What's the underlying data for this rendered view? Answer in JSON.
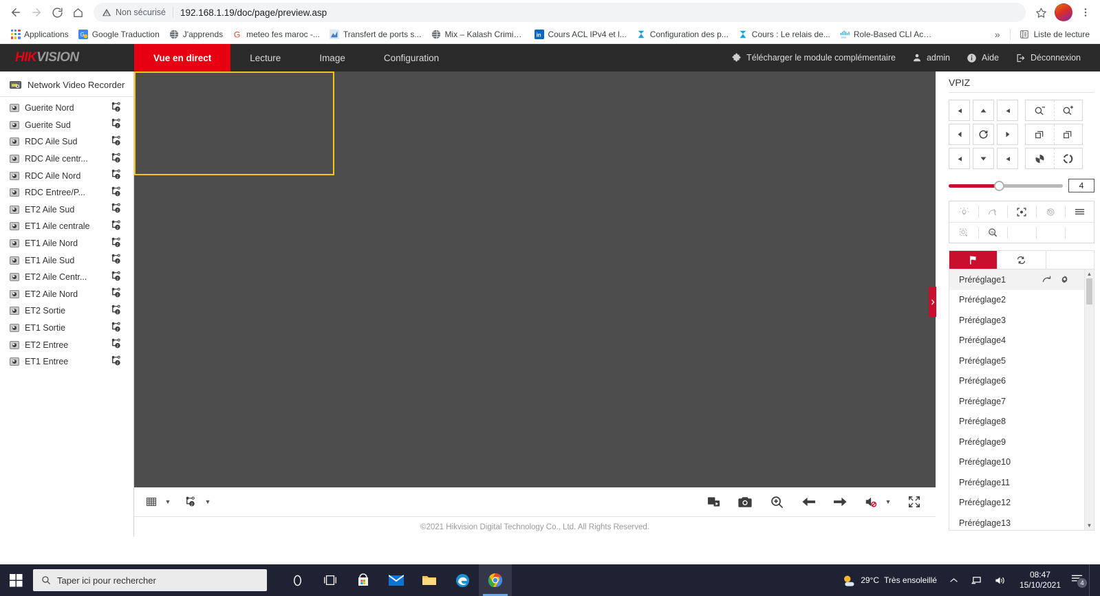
{
  "browser": {
    "back_icon": "back-arrow-icon",
    "forward_icon": "forward-arrow-icon",
    "reload_icon": "reload-icon",
    "home_icon": "home-icon",
    "security_label": "Non sécurisé",
    "url": "192.168.1.19/doc/page/preview.asp",
    "star_icon": "bookmark-star-icon",
    "menu_icon": "kebab-menu-icon",
    "bookmarks": [
      {
        "label": "Applications",
        "icon": "apps-grid-icon"
      },
      {
        "label": "Google Traduction",
        "icon": "google-translate-icon"
      },
      {
        "label": "J'apprends",
        "icon": "globe-icon"
      },
      {
        "label": "meteo fes maroc -...",
        "icon": "google-g-icon"
      },
      {
        "label": "Transfert de ports s...",
        "icon": "chart-icon"
      },
      {
        "label": "Mix – Kalash Crimin...",
        "icon": "globe-icon"
      },
      {
        "label": "Cours ACL IPv4 et l...",
        "icon": "linkedin-icon"
      },
      {
        "label": "Configuration des p...",
        "icon": "netacad-icon"
      },
      {
        "label": "Cours : Le relais de...",
        "icon": "netacad-icon"
      },
      {
        "label": "Role-Based CLI Acc...",
        "icon": "cisco-icon"
      }
    ],
    "overflow_label": "»",
    "reading_list_label": "Liste de lecture",
    "reading_list_icon": "reading-list-icon"
  },
  "hikvision": {
    "logo_red": "HIK",
    "logo_grey": "VISION",
    "nav": [
      {
        "label": "Vue en direct",
        "active": true
      },
      {
        "label": "Lecture",
        "active": false
      },
      {
        "label": "Image",
        "active": false
      },
      {
        "label": "Configuration",
        "active": false
      }
    ],
    "account": [
      {
        "label": "Télécharger le module complémentaire",
        "icon": "puzzle-plugin-icon"
      },
      {
        "label": "admin",
        "icon": "user-icon"
      },
      {
        "label": "Aide",
        "icon": "info-icon"
      },
      {
        "label": "Déconnexion",
        "icon": "logout-icon"
      }
    ]
  },
  "sidebar": {
    "device_label": "Network Video Recorder",
    "device_icon": "nvr-device-icon",
    "cameras": [
      "Guerite Nord",
      "Guerite Sud",
      "RDC Aile Sud",
      "RDC Aile centr...",
      "RDC Aile Nord",
      "RDC Entree/P...",
      "ET2 Aile Sud",
      "ET1 Aile centrale",
      "ET1 Aile Nord",
      "ET1 Aile Sud",
      "ET2 Aile Centr...",
      "ET2 Aile Nord",
      "ET2 Sortie",
      "ET1 Sortie",
      "ET2 Entree",
      "ET1 Entree"
    ]
  },
  "video": {
    "layout": "4x4",
    "cell_count": 16,
    "selected_cell": 1,
    "toolbar_left": [
      {
        "name": "layout-selector",
        "icon": "grid-layout-icon"
      },
      {
        "name": "layout-caret",
        "icon": "chevron-down-icon"
      },
      {
        "name": "stream-selector",
        "icon": "stream-type-icon"
      },
      {
        "name": "stream-caret",
        "icon": "chevron-down-icon"
      }
    ],
    "toolbar_right": [
      {
        "name": "record-button",
        "icon": "record-stack-icon"
      },
      {
        "name": "capture-button",
        "icon": "camera-icon"
      },
      {
        "name": "digital-zoom-button",
        "icon": "magnifier-plus-icon"
      },
      {
        "name": "previous-page-button",
        "icon": "arrow-left-icon"
      },
      {
        "name": "next-page-button",
        "icon": "arrow-right-icon"
      },
      {
        "name": "audio-button",
        "icon": "speaker-muted-icon"
      },
      {
        "name": "audio-caret",
        "icon": "chevron-down-icon"
      },
      {
        "name": "fullscreen-button",
        "icon": "fullscreen-icon"
      }
    ],
    "copyright": "©2021 Hikvision Digital Technology Co., Ltd. All Rights Reserved."
  },
  "ptz": {
    "title": "VPIZ",
    "dpad": [
      {
        "name": "pan-up-left-button",
        "icon": "arrow-up-left-icon"
      },
      {
        "name": "pan-up-button",
        "icon": "arrow-up-icon"
      },
      {
        "name": "pan-up-right-button",
        "icon": "arrow-up-right-icon"
      },
      {
        "name": "pan-left-button",
        "icon": "arrow-left-icon"
      },
      {
        "name": "auto-scan-button",
        "icon": "rotate-icon"
      },
      {
        "name": "pan-right-button",
        "icon": "arrow-right-icon"
      },
      {
        "name": "pan-down-left-button",
        "icon": "arrow-down-left-icon"
      },
      {
        "name": "pan-down-button",
        "icon": "arrow-down-icon"
      },
      {
        "name": "pan-down-right-button",
        "icon": "arrow-down-right-icon"
      }
    ],
    "optics": [
      {
        "minus": "zoom-out-icon",
        "plus": "zoom-in-icon"
      },
      {
        "minus": "focus-near-icon",
        "plus": "focus-far-icon"
      },
      {
        "minus": "iris-close-icon",
        "plus": "iris-open-icon"
      }
    ],
    "speed_value": "4",
    "speed_percent": 44,
    "aux_row1": [
      {
        "name": "light-button",
        "icon": "light-bulb-icon",
        "enabled": false
      },
      {
        "name": "wiper-button",
        "icon": "wiper-icon",
        "enabled": false
      },
      {
        "name": "auxiliary-focus-button",
        "icon": "auto-focus-icon",
        "enabled": true
      },
      {
        "name": "lens-initialize-button",
        "icon": "lens-init-icon",
        "enabled": false
      },
      {
        "name": "manual-tracking-button",
        "icon": "menu-lines-icon",
        "enabled": true
      }
    ],
    "aux_row2": [
      {
        "name": "one-touch-patrol-button",
        "icon": "one-touch-patrol-icon",
        "enabled": false
      },
      {
        "name": "three-d-positioning-button",
        "icon": "3d-positioning-icon",
        "enabled": true
      },
      {
        "name": "aux-empty-1",
        "icon": "",
        "enabled": false
      },
      {
        "name": "aux-empty-2",
        "icon": "",
        "enabled": false
      },
      {
        "name": "aux-empty-3",
        "icon": "",
        "enabled": false
      }
    ],
    "tabs": [
      {
        "name": "preset-tab",
        "icon": "flag-icon",
        "active": true
      },
      {
        "name": "patrol-tab",
        "icon": "refresh-cycle-icon",
        "active": false
      },
      {
        "name": "pattern-tab",
        "icon": "",
        "active": false
      }
    ],
    "presets": [
      {
        "label": "Préréglage1",
        "hover": true
      },
      {
        "label": "Préréglage2",
        "hover": false
      },
      {
        "label": "Préréglage3",
        "hover": false
      },
      {
        "label": "Préréglage4",
        "hover": false
      },
      {
        "label": "Préréglage5",
        "hover": false
      },
      {
        "label": "Préréglage6",
        "hover": false
      },
      {
        "label": "Préréglage7",
        "hover": false
      },
      {
        "label": "Préréglage8",
        "hover": false
      },
      {
        "label": "Préréglage9",
        "hover": false
      },
      {
        "label": "Préréglage10",
        "hover": false
      },
      {
        "label": "Préréglage11",
        "hover": false
      },
      {
        "label": "Préréglage12",
        "hover": false
      },
      {
        "label": "Préréglage13",
        "hover": false
      }
    ],
    "preset_call_icon": "call-preset-icon",
    "preset_settings_icon": "gear-icon",
    "collapse_icon": "chevron-right-icon"
  },
  "taskbar": {
    "start_icon": "windows-start-icon",
    "search_placeholder": "Taper ici pour rechercher",
    "search_icon": "search-icon",
    "apps": [
      {
        "name": "cortana-icon",
        "active": false
      },
      {
        "name": "task-view-icon",
        "active": false
      },
      {
        "name": "microsoft-store-icon",
        "active": false
      },
      {
        "name": "mail-icon",
        "active": false
      },
      {
        "name": "file-explorer-icon",
        "active": false
      },
      {
        "name": "edge-icon",
        "active": false
      },
      {
        "name": "chrome-icon",
        "active": true
      }
    ],
    "weather_temp": "29°C",
    "weather_desc": "Très ensoleillé",
    "weather_icon": "sunny-icon",
    "chevron_icon": "chevron-up-icon",
    "network_icon": "network-icon",
    "volume_icon": "volume-icon",
    "time": "08:47",
    "date": "15/10/2021",
    "notification_icon": "action-center-icon",
    "notification_count": "4"
  }
}
